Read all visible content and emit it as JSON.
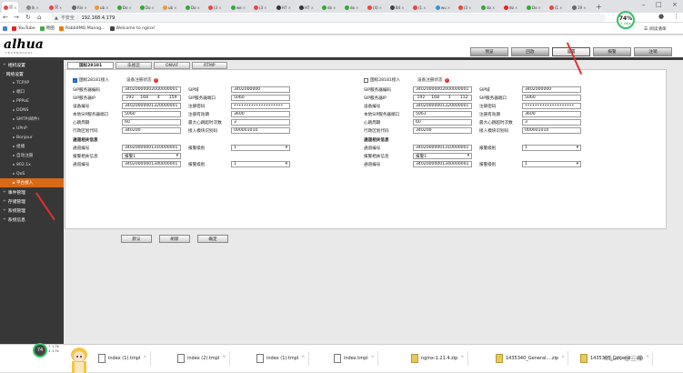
{
  "browser": {
    "tabs": [
      {
        "label": "设",
        "color": "#e44"
      },
      {
        "label": "Ik",
        "color": "#888"
      },
      {
        "label": "设",
        "color": "#e44"
      },
      {
        "label": "Rin",
        "color": "#666"
      },
      {
        "label": "ub",
        "color": "#e93"
      },
      {
        "label": "Do",
        "color": "#3a3"
      },
      {
        "label": "Do",
        "color": "#3a3"
      },
      {
        "label": "ub",
        "color": "#e93"
      },
      {
        "label": "Do",
        "color": "#3a3"
      },
      {
        "label": "(3",
        "color": "#e44"
      },
      {
        "label": "we",
        "color": "#3a3"
      },
      {
        "label": "(3",
        "color": "#e44"
      },
      {
        "label": "H7",
        "color": "#333"
      },
      {
        "label": "H7",
        "color": "#333"
      },
      {
        "label": "do",
        "color": "#3a3"
      },
      {
        "label": "do",
        "color": "#3a3"
      },
      {
        "label": "(4)",
        "color": "#e44"
      },
      {
        "label": "84",
        "color": "#444"
      },
      {
        "label": "(1",
        "color": "#e44"
      },
      {
        "label": "wu",
        "color": "#39c"
      },
      {
        "label": "(3",
        "color": "#e44"
      },
      {
        "label": "do",
        "color": "#3a3"
      },
      {
        "label": "do",
        "color": "#e22"
      },
      {
        "label": "Do",
        "color": "#3a3"
      },
      {
        "label": "(1",
        "color": "#e44"
      },
      {
        "label": "19",
        "color": "#666"
      }
    ],
    "security_label": "不安全",
    "url": "192.168.4.179",
    "bookmarks": [
      {
        "label": "YouTube",
        "color": "#e22"
      },
      {
        "label": "地图",
        "color": "#4a4"
      },
      {
        "label": "RabbitMQ Manag...",
        "color": "#e70"
      },
      {
        "label": "Welcome to nginx!",
        "color": "#444"
      }
    ],
    "reading_list": "阅读清单",
    "speed_badge": {
      "percent": "74%",
      "sub": "↑ 0K/s"
    }
  },
  "app": {
    "logo": "alhua",
    "logo_sub": "TECHNOLOGY",
    "main_tabs": [
      {
        "label": "预览",
        "selected": false
      },
      {
        "label": "回放",
        "selected": false
      },
      {
        "label": "设置",
        "selected": true
      },
      {
        "label": "报警",
        "selected": false
      },
      {
        "label": "注销",
        "selected": false
      }
    ],
    "sidebar": {
      "groups": [
        {
          "label": "相机设置",
          "toggle": "+"
        },
        {
          "label": "网络设置",
          "toggle": "-"
        }
      ],
      "items": [
        {
          "label": "TCP/IP"
        },
        {
          "label": "端口"
        },
        {
          "label": "PPPoE"
        },
        {
          "label": "DDNS"
        },
        {
          "label": "SMTP(邮件)"
        },
        {
          "label": "UPnP"
        },
        {
          "label": "Bonjour"
        },
        {
          "label": "组播"
        },
        {
          "label": "自动注册"
        },
        {
          "label": "802.1x"
        },
        {
          "label": "QoS"
        },
        {
          "label": "平台接入"
        }
      ],
      "groups_after": [
        {
          "label": "事件管理",
          "toggle": "+"
        },
        {
          "label": "存储管理",
          "toggle": "+"
        },
        {
          "label": "系统管理",
          "toggle": "+"
        },
        {
          "label": "系统信息",
          "toggle": "+"
        }
      ]
    },
    "content_tabs": [
      {
        "label": "国标28181",
        "selected": true
      },
      {
        "label": "乐视云",
        "selected": false
      },
      {
        "label": "ONVIF",
        "selected": false
      },
      {
        "label": "RTMP",
        "selected": false
      }
    ],
    "left_form": {
      "enable_label": "国标28181接入",
      "enabled": true,
      "status_label": "设备注册状态",
      "fields_left": [
        {
          "label": "SIP服务器编码",
          "value": "34020000002000000001"
        },
        {
          "label": "SIP服务器IP",
          "ip": [
            "192",
            "168",
            "4",
            "159"
          ]
        },
        {
          "label": "设备编号",
          "value": "34020000001320000001"
        },
        {
          "label": "本地SIP服务器端口",
          "value": "5060"
        },
        {
          "label": "心跳周期",
          "value": "60"
        },
        {
          "label": "行政区划代码",
          "value": "340200"
        }
      ],
      "fields_right": [
        {
          "label": "SIP域",
          "value": "3402000000"
        },
        {
          "label": "SIP服务器端口",
          "value": "5060"
        },
        {
          "label": "注册密码",
          "value": "••••••••••••••••••••"
        },
        {
          "label": "注册有效期",
          "value": "3600"
        },
        {
          "label": "最大心跳超时次数",
          "value": "3"
        },
        {
          "label": "接入模块识别码",
          "value": "000001010"
        }
      ],
      "channel_section_title": "通道相关信息",
      "channel_rows": [
        {
          "label": "通道编号",
          "value": "34020000001310000001",
          "level_label": "报警级别",
          "level": "1"
        },
        {
          "label": "报警相关信息",
          "select": "报警1"
        },
        {
          "label": "通道编号",
          "value": "34020000001340000001",
          "level_label": "报警级别",
          "level": "1"
        }
      ]
    },
    "right_form": {
      "enable_label": "国标28181接入",
      "enabled": false,
      "status_label": "设备注册状态",
      "fields_left": [
        {
          "label": "SIP服务器编码",
          "value": "34020000002000000001"
        },
        {
          "label": "SIP服务器IP",
          "ip": [
            "192",
            "168",
            "1",
            "112"
          ]
        },
        {
          "label": "设备编号",
          "value": "34020000001320000001"
        },
        {
          "label": "本地SIP服务器端口",
          "value": "5061"
        },
        {
          "label": "心跳周期",
          "value": "60"
        },
        {
          "label": "行政区划代码",
          "value": "340200"
        }
      ],
      "fields_right": [
        {
          "label": "SIP域",
          "value": "3402000000"
        },
        {
          "label": "SIP服务器端口",
          "value": "5060"
        },
        {
          "label": "注册密码",
          "value": "••••••••••••••••••••"
        },
        {
          "label": "注册有效期",
          "value": "3600"
        },
        {
          "label": "最大心跳超时次数",
          "value": "3"
        },
        {
          "label": "接入模块识别码",
          "value": "000001010"
        }
      ],
      "channel_section_title": "通道相关信息",
      "channel_rows": [
        {
          "label": "通道编号",
          "value": "34020000001310000001",
          "level_label": "报警级别",
          "level": "1"
        },
        {
          "label": "报警相关信息",
          "select": "报警1"
        },
        {
          "label": "通道编号",
          "value": "34020000001340000001",
          "level_label": "报警级别",
          "level": "1"
        }
      ]
    },
    "buttons": {
      "default": "默认",
      "refresh": "刷新",
      "confirm": "确定"
    }
  },
  "taskbar": {
    "tray_badge": "74",
    "tray_net": [
      "↑ 1.7k",
      "↓ 1.7k"
    ],
    "downloads": [
      {
        "label": "index (1).tmpl",
        "type": "file"
      },
      {
        "label": "index (2).tmpl",
        "type": "file"
      },
      {
        "label": "index (1).tmpl",
        "type": "file"
      },
      {
        "label": "index.tmpl",
        "type": "file"
      },
      {
        "label": "nginx-1.21.4.zip",
        "type": "zip"
      },
      {
        "label": "1435340_General....zip",
        "type": "zip"
      },
      {
        "label": "1435340_General....zip",
        "type": "zip"
      }
    ],
    "csdn": "CSDN @三希"
  }
}
